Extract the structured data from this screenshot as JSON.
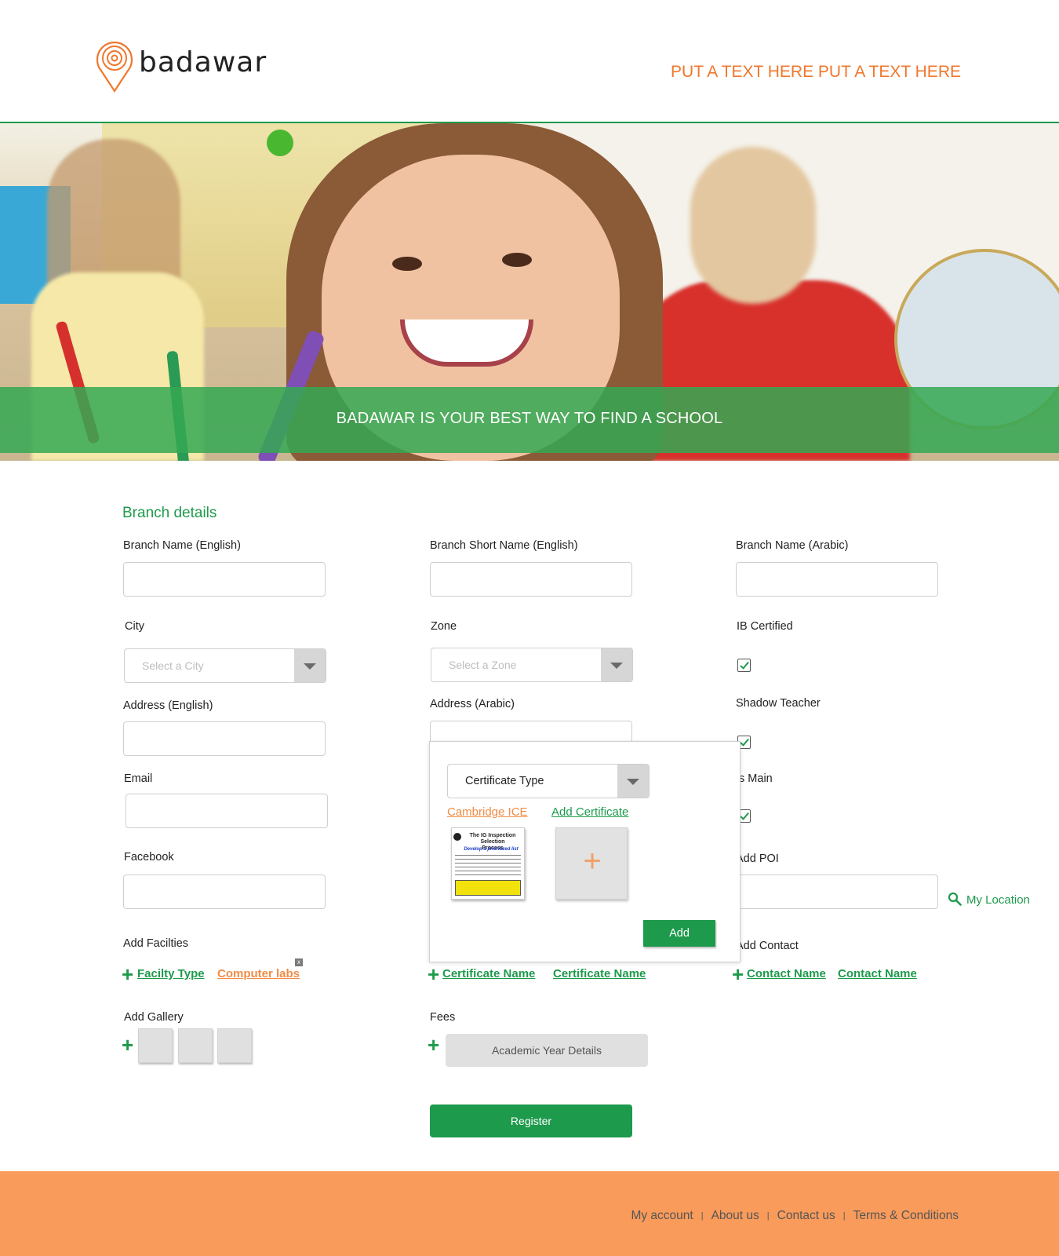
{
  "header": {
    "brand": "badawar",
    "tagline": "PUT A TEXT HERE PUT A TEXT HERE"
  },
  "hero": {
    "banner_text": "BADAWAR IS YOUR BEST WAY TO FIND A SCHOOL"
  },
  "form": {
    "section_title": "Branch details",
    "branch_name_en_label": "Branch Name (English)",
    "branch_short_name_label": "Branch Short Name (English)",
    "branch_name_ar_label": "Branch  Name (Arabic)",
    "city_label": "City",
    "city_placeholder": "Select a City",
    "zone_label": "Zone",
    "zone_placeholder": "Select a Zone",
    "ib_certified_label": "IB Certified",
    "address_en_label": "Address (English)",
    "address_ar_label": "Address (Arabic)",
    "shadow_teacher_label": "Shadow Teacher",
    "email_label": "Email",
    "is_main_label": "Is Main",
    "facebook_label": "Facebook",
    "add_poi_label": "Add POI",
    "my_location_label": "My Location",
    "add_facilities_label": "Add Facilties",
    "facility_type_link": "Facilty Type",
    "facility_item": "Computer labs",
    "remove_glyph": "x",
    "certificate_name_1": "Certificate Name",
    "certificate_name_2": "Certificate Name",
    "add_contact_label": "Add Contact",
    "contact_name_1": "Contact Name",
    "contact_name_2": "Contact Name",
    "add_gallery_label": "Add Gallery",
    "fees_label": "Fees",
    "academic_year_label": "Academic Year Details",
    "register_label": "Register",
    "add_glyph": "+"
  },
  "certificate_popup": {
    "certificate_type_placeholder": "Certificate Type",
    "cambridge_link": "Cambridge ICE",
    "add_certificate_link": "Add Certificate",
    "thumb_title": "The IG Inspection Selection Process",
    "thumb_subtitle": "Develop a prioritized list",
    "add_button": "Add"
  },
  "footer": {
    "links": [
      "My account",
      "About us",
      "Contact us",
      "Terms & Conditions"
    ],
    "separator": "|"
  },
  "colors": {
    "brand_green": "#1e9a4c",
    "brand_orange": "#f0772c",
    "footer_orange": "#f99b5b"
  }
}
